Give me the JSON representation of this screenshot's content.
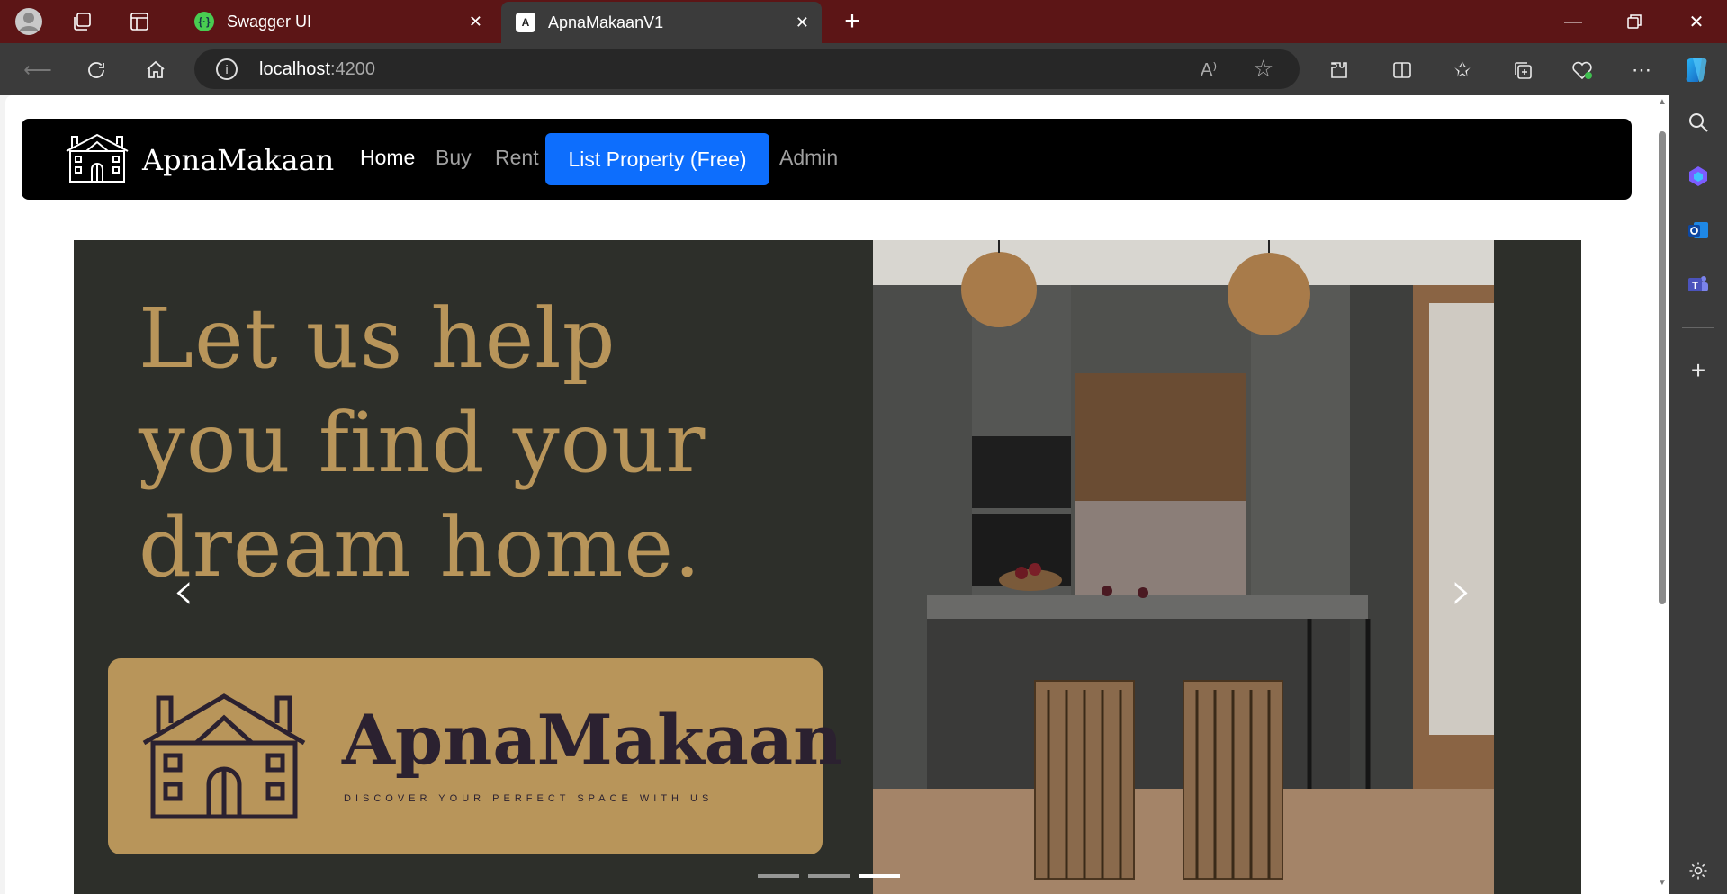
{
  "browser": {
    "tabs": [
      {
        "title": "Swagger UI",
        "favicon": "swagger-icon"
      },
      {
        "title": "ApnaMakaanV1",
        "favicon": "angular-icon"
      }
    ],
    "address": {
      "host": "localhost",
      "port": ":4200"
    }
  },
  "app": {
    "brand": "ApnaMakaan",
    "nav": {
      "home": "Home",
      "buy": "Buy",
      "rent": "Rent",
      "list_property": "List Property (Free)",
      "admin": "Admin"
    },
    "carousel": {
      "headline_1": "Let us help",
      "headline_2": "you find your",
      "headline_3": "dream home.",
      "card_brand": "ApnaMakaan",
      "card_tagline": "DISCOVER YOUR PERFECT SPACE WITH US",
      "active_slide": 3,
      "slide_count": 3
    }
  },
  "colors": {
    "titlebar": "#5c1516",
    "accent_button": "#0d6efd",
    "gold": "#b8955a",
    "hero_bg": "#2d2f2a"
  }
}
